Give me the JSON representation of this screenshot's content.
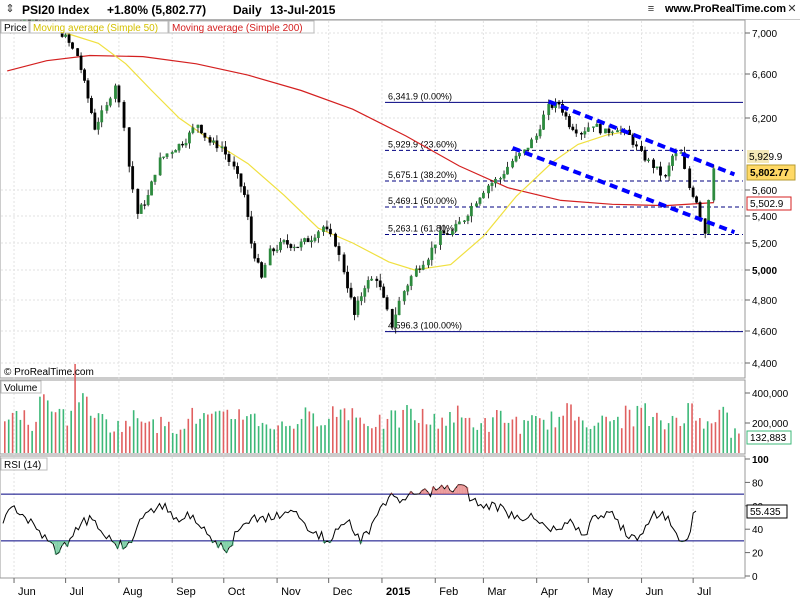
{
  "header": {
    "title": "PSI20 Index",
    "change": "+1.80% (5,802.77)",
    "period": "Daily",
    "date": "13-Jul-2015",
    "site": "www.ProRealTime.com",
    "icons": [
      "up-down-arrow-icon",
      "menu-icon",
      "close-icon"
    ]
  },
  "legend": {
    "price_label": "Price",
    "ma50_label": "Moving average (Simple 50)",
    "ma200_label": "Moving average (Simple 200)",
    "copyright": "© ProRealTime.com",
    "volume_label": "Volume",
    "rsi_label": "RSI (14)"
  },
  "colors": {
    "ma50": "#f0e040",
    "ma200": "#d42020",
    "fib": "#000080",
    "channel": "#0000ff",
    "volume_up": "#3cb878",
    "volume_down": "#e06060",
    "candle_up": "#2d8a3e",
    "candle_down": "#000000",
    "price_tag": "#ffd966",
    "rsi_tag": "#ffffff"
  },
  "price_axis": {
    "ticks": [
      "7,000",
      "6,600",
      "6,200",
      "5,600",
      "5,400",
      "5,200",
      "5,000",
      "4,800",
      "4,600",
      "4,400"
    ],
    "bold_tick": "5,000",
    "tags": {
      "last": "5,802.77",
      "ma200": "5,502.9",
      "hidden_level": "5,929.9"
    }
  },
  "volume_axis": {
    "ticks": [
      "400,000",
      "200,000"
    ],
    "tag": "132,883"
  },
  "rsi_axis": {
    "ticks": [
      "100",
      "80",
      "60",
      "40",
      "20",
      "0"
    ],
    "tag": "55.435"
  },
  "x_axis": {
    "labels": [
      "Jun",
      "Jul",
      "Aug",
      "Sep",
      "Oct",
      "Nov",
      "Dec",
      "2015",
      "Feb",
      "Mar",
      "Apr",
      "May",
      "Jun",
      "Jul"
    ],
    "bold_label": "2015"
  },
  "chart_data": {
    "type": "line",
    "title": "PSI20 Index",
    "subtitle": "+1.80% (5,802.77) Daily 13-Jul-2015",
    "x_range": [
      "2014-05",
      "2015-07-13"
    ],
    "ylim": [
      4300,
      7100
    ],
    "last_close": 5802.77,
    "fibonacci_levels": [
      {
        "label": "6,341.9 (0.00%)",
        "value": 6341.9
      },
      {
        "label": "5,929.9 (23.60%)",
        "value": 5929.9
      },
      {
        "label": "5,675.1 (38.20%)",
        "value": 5675.1
      },
      {
        "label": "5,469.1 (50.00%)",
        "value": 5469.1
      },
      {
        "label": "5,263.1 (61.80%)",
        "value": 5263.1
      },
      {
        "label": "4,596.3 (100.00%)",
        "value": 4596.3
      }
    ],
    "close_series": [
      {
        "x": "2014-05-28",
        "y": 7000
      },
      {
        "x": "2014-06-10",
        "y": 7150
      },
      {
        "x": "2014-06-25",
        "y": 7050
      },
      {
        "x": "2014-07-01",
        "y": 6960
      },
      {
        "x": "2014-07-08",
        "y": 6780
      },
      {
        "x": "2014-07-14",
        "y": 6380
      },
      {
        "x": "2014-07-18",
        "y": 6120
      },
      {
        "x": "2014-07-25",
        "y": 6300
      },
      {
        "x": "2014-07-30",
        "y": 6510
      },
      {
        "x": "2014-08-04",
        "y": 6150
      },
      {
        "x": "2014-08-07",
        "y": 5800
      },
      {
        "x": "2014-08-12",
        "y": 5420
      },
      {
        "x": "2014-08-18",
        "y": 5550
      },
      {
        "x": "2014-08-25",
        "y": 5850
      },
      {
        "x": "2014-09-01",
        "y": 5930
      },
      {
        "x": "2014-09-09",
        "y": 6020
      },
      {
        "x": "2014-09-16",
        "y": 6150
      },
      {
        "x": "2014-09-23",
        "y": 6000
      },
      {
        "x": "2014-09-30",
        "y": 5960
      },
      {
        "x": "2014-10-07",
        "y": 5780
      },
      {
        "x": "2014-10-13",
        "y": 5560
      },
      {
        "x": "2014-10-17",
        "y": 5200
      },
      {
        "x": "2014-10-23",
        "y": 4940
      },
      {
        "x": "2014-10-28",
        "y": 5130
      },
      {
        "x": "2014-11-05",
        "y": 5200
      },
      {
        "x": "2014-11-13",
        "y": 5180
      },
      {
        "x": "2014-11-21",
        "y": 5240
      },
      {
        "x": "2014-11-28",
        "y": 5320
      },
      {
        "x": "2014-12-05",
        "y": 5200
      },
      {
        "x": "2014-12-10",
        "y": 5000
      },
      {
        "x": "2014-12-16",
        "y": 4700
      },
      {
        "x": "2014-12-22",
        "y": 4900
      },
      {
        "x": "2014-12-29",
        "y": 4950
      },
      {
        "x": "2015-01-07",
        "y": 4640
      },
      {
        "x": "2015-01-14",
        "y": 4860
      },
      {
        "x": "2015-01-21",
        "y": 5000
      },
      {
        "x": "2015-01-28",
        "y": 5100
      },
      {
        "x": "2015-02-04",
        "y": 5260
      },
      {
        "x": "2015-02-11",
        "y": 5280
      },
      {
        "x": "2015-02-18",
        "y": 5380
      },
      {
        "x": "2015-02-25",
        "y": 5520
      },
      {
        "x": "2015-03-04",
        "y": 5640
      },
      {
        "x": "2015-03-11",
        "y": 5700
      },
      {
        "x": "2015-03-18",
        "y": 5840
      },
      {
        "x": "2015-03-25",
        "y": 5920
      },
      {
        "x": "2015-04-01",
        "y": 6050
      },
      {
        "x": "2015-04-08",
        "y": 6300
      },
      {
        "x": "2015-04-14",
        "y": 6330
      },
      {
        "x": "2015-04-20",
        "y": 6150
      },
      {
        "x": "2015-04-27",
        "y": 6080
      },
      {
        "x": "2015-05-04",
        "y": 6150
      },
      {
        "x": "2015-05-11",
        "y": 6080
      },
      {
        "x": "2015-05-18",
        "y": 6120
      },
      {
        "x": "2015-05-25",
        "y": 6050
      },
      {
        "x": "2015-06-01",
        "y": 5900
      },
      {
        "x": "2015-06-08",
        "y": 5800
      },
      {
        "x": "2015-06-15",
        "y": 5700
      },
      {
        "x": "2015-06-19",
        "y": 5880
      },
      {
        "x": "2015-06-24",
        "y": 5900
      },
      {
        "x": "2015-06-29",
        "y": 5620
      },
      {
        "x": "2015-07-03",
        "y": 5520
      },
      {
        "x": "2015-07-08",
        "y": 5280
      },
      {
        "x": "2015-07-13",
        "y": 5802.77
      }
    ],
    "ma50_series": [
      {
        "x": "2014-07-01",
        "y": 7000
      },
      {
        "x": "2014-07-20",
        "y": 6900
      },
      {
        "x": "2014-08-05",
        "y": 6700
      },
      {
        "x": "2014-08-20",
        "y": 6450
      },
      {
        "x": "2014-09-05",
        "y": 6200
      },
      {
        "x": "2014-09-25",
        "y": 6000
      },
      {
        "x": "2014-10-15",
        "y": 5820
      },
      {
        "x": "2014-11-05",
        "y": 5560
      },
      {
        "x": "2014-11-25",
        "y": 5310
      },
      {
        "x": "2014-12-15",
        "y": 5200
      },
      {
        "x": "2015-01-05",
        "y": 5060
      },
      {
        "x": "2015-01-20",
        "y": 5000
      },
      {
        "x": "2015-02-10",
        "y": 5040
      },
      {
        "x": "2015-03-01",
        "y": 5250
      },
      {
        "x": "2015-03-20",
        "y": 5550
      },
      {
        "x": "2015-04-10",
        "y": 5830
      },
      {
        "x": "2015-04-25",
        "y": 5980
      },
      {
        "x": "2015-05-12",
        "y": 6060
      },
      {
        "x": "2015-05-25",
        "y": 6090
      }
    ],
    "ma200_series": [
      {
        "x": "2014-05-28",
        "y": 6630
      },
      {
        "x": "2014-06-20",
        "y": 6730
      },
      {
        "x": "2014-07-15",
        "y": 6780
      },
      {
        "x": "2014-08-15",
        "y": 6770
      },
      {
        "x": "2014-09-15",
        "y": 6700
      },
      {
        "x": "2014-10-15",
        "y": 6590
      },
      {
        "x": "2014-11-15",
        "y": 6450
      },
      {
        "x": "2014-12-15",
        "y": 6280
      },
      {
        "x": "2015-01-15",
        "y": 6050
      },
      {
        "x": "2015-02-15",
        "y": 5800
      },
      {
        "x": "2015-03-15",
        "y": 5620
      },
      {
        "x": "2015-04-15",
        "y": 5520
      },
      {
        "x": "2015-05-15",
        "y": 5490
      },
      {
        "x": "2015-06-15",
        "y": 5480
      },
      {
        "x": "2015-07-13",
        "y": 5502.9
      }
    ],
    "channel_lines": [
      {
        "from": {
          "x": "2015-04-08",
          "y": 6350
        },
        "to": {
          "x": "2015-07-25",
          "y": 5730
        }
      },
      {
        "from": {
          "x": "2015-03-18",
          "y": 5950
        },
        "to": {
          "x": "2015-07-25",
          "y": 5280
        }
      }
    ],
    "volume": {
      "last": 132883,
      "ylim": [
        0,
        480000
      ],
      "values": [
        210000,
        280000,
        190000,
        320000,
        240000,
        260000,
        460000,
        300000,
        220000,
        180000,
        200000,
        230000,
        260000,
        190000,
        170000,
        210000,
        240000,
        230000,
        220000,
        250000,
        280000,
        230000,
        200000,
        180000,
        190000,
        240000,
        220000,
        260000,
        270000,
        300000,
        230000,
        210000,
        200000,
        220000,
        260000,
        240000,
        210000,
        230000,
        250000,
        220000,
        200000,
        190000,
        240000,
        210000,
        180000,
        200000,
        220000,
        230000,
        260000,
        240000,
        220000,
        200000,
        230000,
        250000,
        270000,
        210000,
        190000,
        240000,
        280000,
        220000,
        250000,
        260000,
        132883
      ]
    },
    "rsi": {
      "period": 14,
      "last": 55.435,
      "ylim": [
        0,
        100
      ],
      "bands": [
        30,
        70
      ],
      "values": [
        45,
        60,
        50,
        40,
        30,
        20,
        32,
        45,
        48,
        35,
        28,
        25,
        42,
        55,
        62,
        55,
        48,
        52,
        42,
        30,
        20,
        38,
        45,
        50,
        48,
        52,
        55,
        45,
        38,
        30,
        40,
        48,
        28,
        45,
        62,
        68,
        65,
        70,
        72,
        75,
        73,
        78,
        65,
        58,
        62,
        55,
        52,
        50,
        45,
        38,
        40,
        45,
        35,
        52,
        55,
        48,
        32,
        35,
        50,
        55,
        40,
        30,
        55.435
      ]
    }
  }
}
